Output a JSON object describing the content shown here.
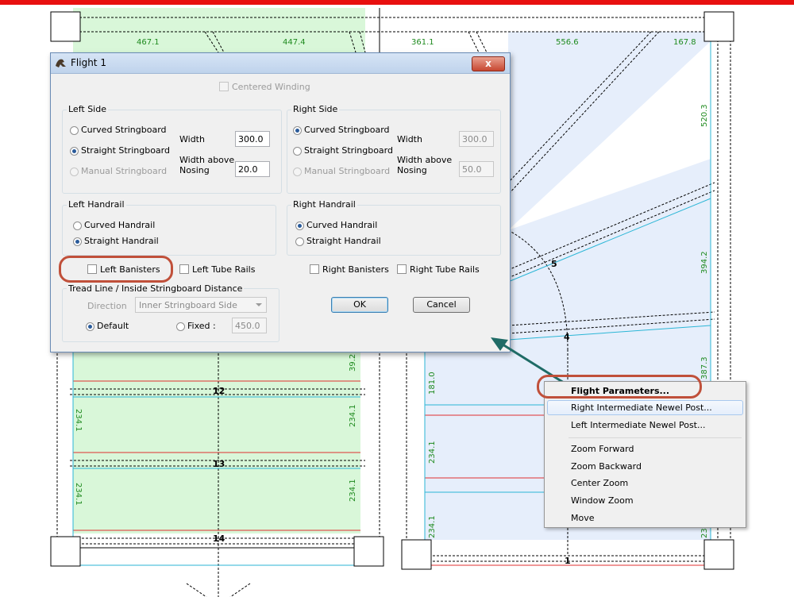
{
  "dialog": {
    "title": "Flight 1",
    "close_label": "x",
    "centered_winding": "Centered Winding",
    "left_side": {
      "title": "Left Side",
      "options": [
        "Curved Stringboard",
        "Straight Stringboard",
        "Manual Stringboard"
      ],
      "width_label": "Width",
      "width_value": "300.0",
      "width_above_label_1": "Width above",
      "width_above_label_2": "Nosing",
      "width_above_value": "20.0"
    },
    "right_side": {
      "title": "Right Side",
      "options": [
        "Curved Stringboard",
        "Straight Stringboard",
        "Manual Stringboard"
      ],
      "width_label": "Width",
      "width_value": "300.0",
      "width_above_label_1": "Width above",
      "width_above_label_2": "Nosing",
      "width_above_value": "50.0"
    },
    "left_handrail": {
      "title": "Left Handrail",
      "options": [
        "Curved Handrail",
        "Straight Handrail"
      ]
    },
    "right_handrail": {
      "title": "Right Handrail",
      "options": [
        "Curved Handrail",
        "Straight Handrail"
      ]
    },
    "checks": {
      "left_banisters": "Left Banisters",
      "left_tube_rails": "Left Tube Rails",
      "right_banisters": "Right Banisters",
      "right_tube_rails": "Right Tube Rails"
    },
    "tread": {
      "title": "Tread Line / Inside Stringboard Distance",
      "direction_label": "Direction",
      "direction_value": "Inner Stringboard Side",
      "default_label": "Default",
      "fixed_label": "Fixed :",
      "fixed_value": "450.0"
    },
    "ok_label": "OK",
    "cancel_label": "Cancel"
  },
  "context_menu": {
    "items": [
      "Flight Parameters...",
      "Right Intermediate Newel Post...",
      "Left Intermediate Newel Post...",
      "Zoom Forward",
      "Zoom Backward",
      "Center Zoom",
      "Window Zoom",
      "Move"
    ]
  },
  "drawing": {
    "top_dims": [
      "467.1",
      "447.4",
      "361.1",
      "556.6",
      "167.8"
    ],
    "right_dims": [
      "520.3",
      "394.2",
      "387.3",
      "23"
    ],
    "left_dims": [
      "234.1",
      "234.1"
    ],
    "mid_dims": [
      "39.2",
      "234.1",
      "234.1"
    ],
    "inner_dims": [
      "181.0",
      "234.1",
      "234.1"
    ],
    "step_labels": [
      "5",
      "4",
      "12",
      "13",
      "14",
      "1"
    ]
  },
  "colors": {
    "highlight_ring": "#c0503a",
    "red_bar": "#e8100f",
    "green_fill": "#d9f7d9",
    "blue_fill": "#e6eefb",
    "dimension_text": "#1e8a1e"
  }
}
